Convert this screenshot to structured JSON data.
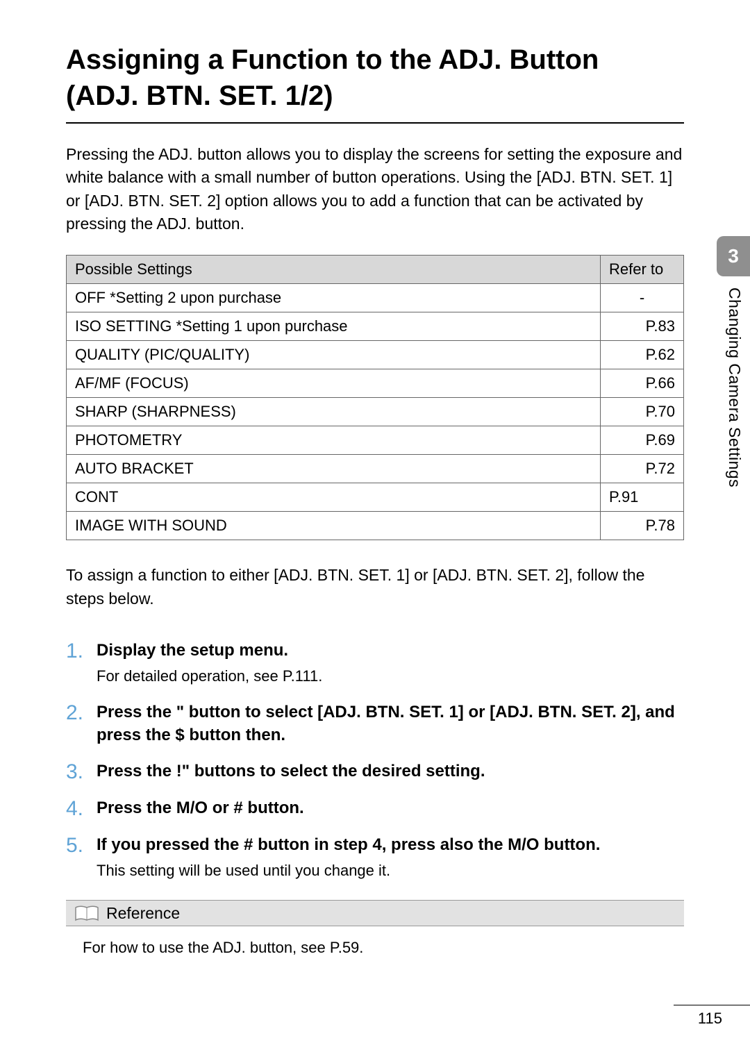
{
  "title_line1": "Assigning a Function to the ADJ. Button",
  "title_line2": "(ADJ. BTN. SET. 1/2)",
  "intro": "Pressing the ADJ. button allows you to display the screens for setting the exposure and white balance with a small number of button operations. Using the [ADJ. BTN. SET. 1] or [ADJ. BTN. SET. 2] option allows you to add a function that can be activated by pressing the ADJ. button.",
  "table": {
    "head_setting": "Possible Settings",
    "head_refer": "Refer to",
    "rows": [
      {
        "setting": "OFF  *Setting 2 upon purchase",
        "ref": "-",
        "align": "center"
      },
      {
        "setting": "ISO SETTING *Setting 1 upon purchase",
        "ref": "P.83",
        "align": "right"
      },
      {
        "setting": "QUALITY (PIC/QUALITY)",
        "ref": "P.62",
        "align": "right"
      },
      {
        "setting": "AF/MF (FOCUS)",
        "ref": "P.66",
        "align": "right"
      },
      {
        "setting": "SHARP (SHARPNESS)",
        "ref": "P.70",
        "align": "right"
      },
      {
        "setting": "PHOTOMETRY",
        "ref": "P.69",
        "align": "right"
      },
      {
        "setting": "AUTO BRACKET",
        "ref": "P.72",
        "align": "right"
      },
      {
        "setting": "CONT",
        "ref": "P.91",
        "align": "left"
      },
      {
        "setting": "IMAGE WITH SOUND",
        "ref": "P.78",
        "align": "right"
      }
    ]
  },
  "follow_text": "To assign a function to either [ADJ. BTN. SET. 1] or [ADJ. BTN. SET. 2], follow the steps below.",
  "steps": [
    {
      "num": "1.",
      "title": "Display the setup menu.",
      "sub": "For detailed operation, see P.111."
    },
    {
      "num": "2.",
      "title": "Press the \"  button to select [ADJ. BTN. SET. 1] or [ADJ. BTN. SET. 2], and press the $  button then.",
      "sub": ""
    },
    {
      "num": "3.",
      "title": "Press the !\"  buttons to select the desired setting.",
      "sub": ""
    },
    {
      "num": "4.",
      "title": "Press the M/O or # button.",
      "sub": ""
    },
    {
      "num": "5.",
      "title": "If you pressed the # button in step 4, press also the M/O button.",
      "sub": "This setting will be used until you change it."
    }
  ],
  "reference_label": "Reference",
  "reference_text": "For how to use the ADJ. button, see P.59.",
  "side_tab_number": "3",
  "side_tab_text": "Changing Camera Settings",
  "page_number": "115"
}
